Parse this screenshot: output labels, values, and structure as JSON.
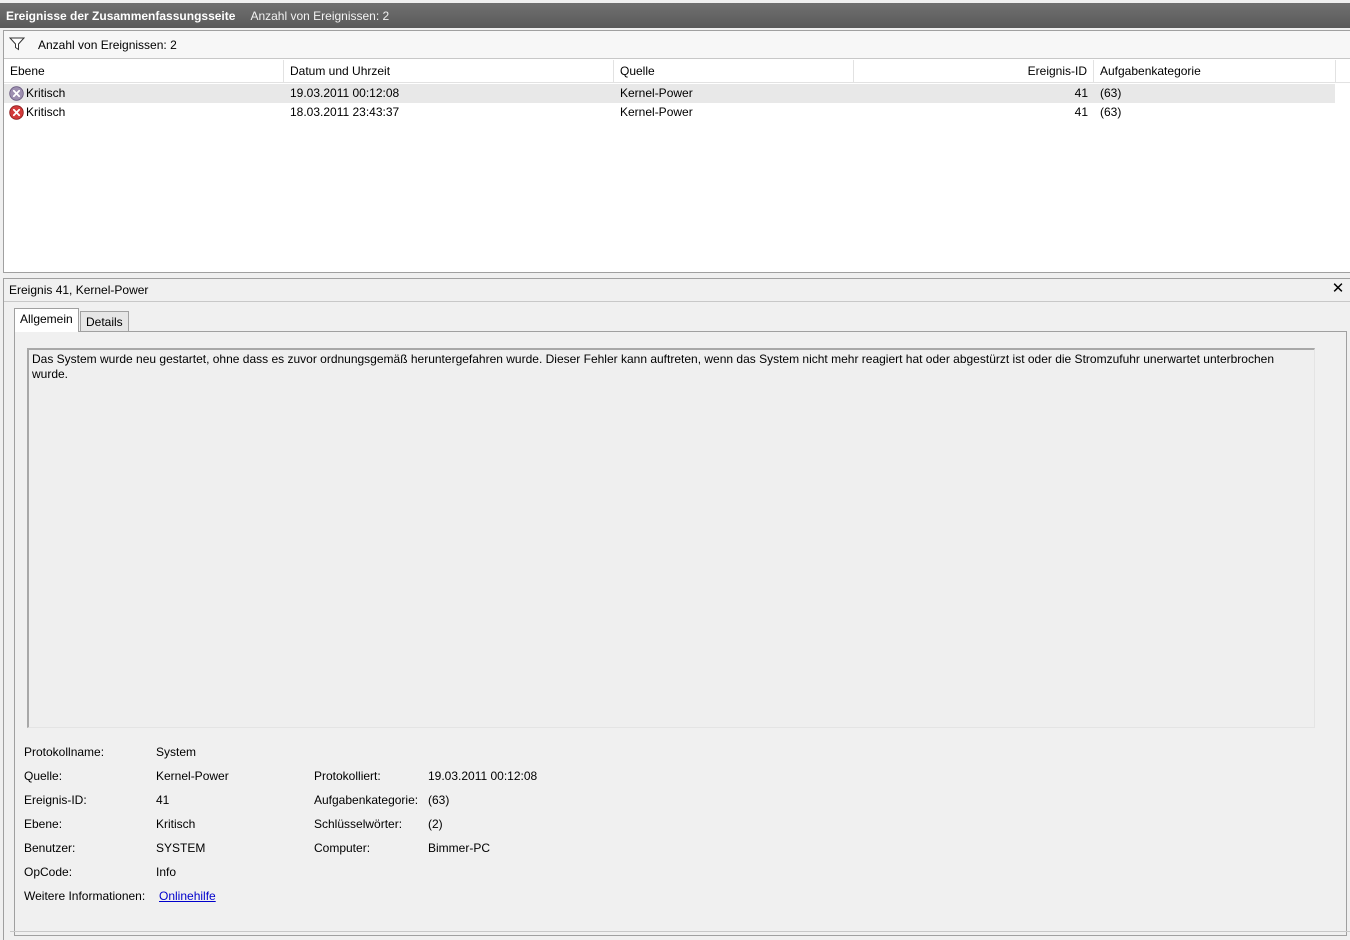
{
  "titlebar": {
    "title": "Ereignisse der Zusammenfassungsseite",
    "count": "Anzahl von Ereignissen: 2"
  },
  "filterbar": {
    "icon": "filter-icon",
    "text": "Anzahl von Ereignissen: 2"
  },
  "columns": {
    "level": "Ebene",
    "datetime": "Datum und Uhrzeit",
    "source": "Quelle",
    "event_id": "Ereignis-ID",
    "task_category": "Aufgabenkategorie"
  },
  "rows": [
    {
      "level": "Kritisch",
      "icon": "critical-error-icon",
      "datetime": "19.03.2011 00:12:08",
      "source": "Kernel-Power",
      "event_id": "41",
      "task_category": "(63)",
      "selected": true
    },
    {
      "level": "Kritisch",
      "icon": "critical-error-icon",
      "datetime": "18.03.2011 23:43:37",
      "source": "Kernel-Power",
      "event_id": "41",
      "task_category": "(63)",
      "selected": false
    }
  ],
  "detail": {
    "header": "Ereignis 41, Kernel-Power",
    "close_icon": "close-icon",
    "tabs": [
      "Allgemein",
      "Details"
    ],
    "message": "Das System wurde neu gestartet, ohne dass es zuvor ordnungsgemäß heruntergefahren wurde. Dieser Fehler kann auftreten, wenn das System nicht mehr reagiert hat oder abgestürzt ist oder die Stromzufuhr unerwartet unterbrochen wurde.",
    "props": {
      "log_name_label": "Protokollname:",
      "log_name": "System",
      "source_label": "Quelle:",
      "source": "Kernel-Power",
      "logged_label": "Protokolliert:",
      "logged": "19.03.2011 00:12:08",
      "event_id_label": "Ereignis-ID:",
      "event_id": "41",
      "task_category_label": "Aufgabenkategorie:",
      "task_category": "(63)",
      "level_label": "Ebene:",
      "level": "Kritisch",
      "keywords_label": "Schlüsselwörter:",
      "keywords": "(2)",
      "user_label": "Benutzer:",
      "user": "SYSTEM",
      "computer_label": "Computer:",
      "computer": "Bimmer-PC",
      "opcode_label": "OpCode:",
      "opcode": "Info",
      "more_info_label": "Weitere Informationen:",
      "more_info_link": "Onlinehilfe"
    }
  },
  "colors": {
    "titlebar": "#5f5f5f",
    "critical": "#c42b2b",
    "link": "#0000cc",
    "selected_row": "#e8e8e8"
  }
}
